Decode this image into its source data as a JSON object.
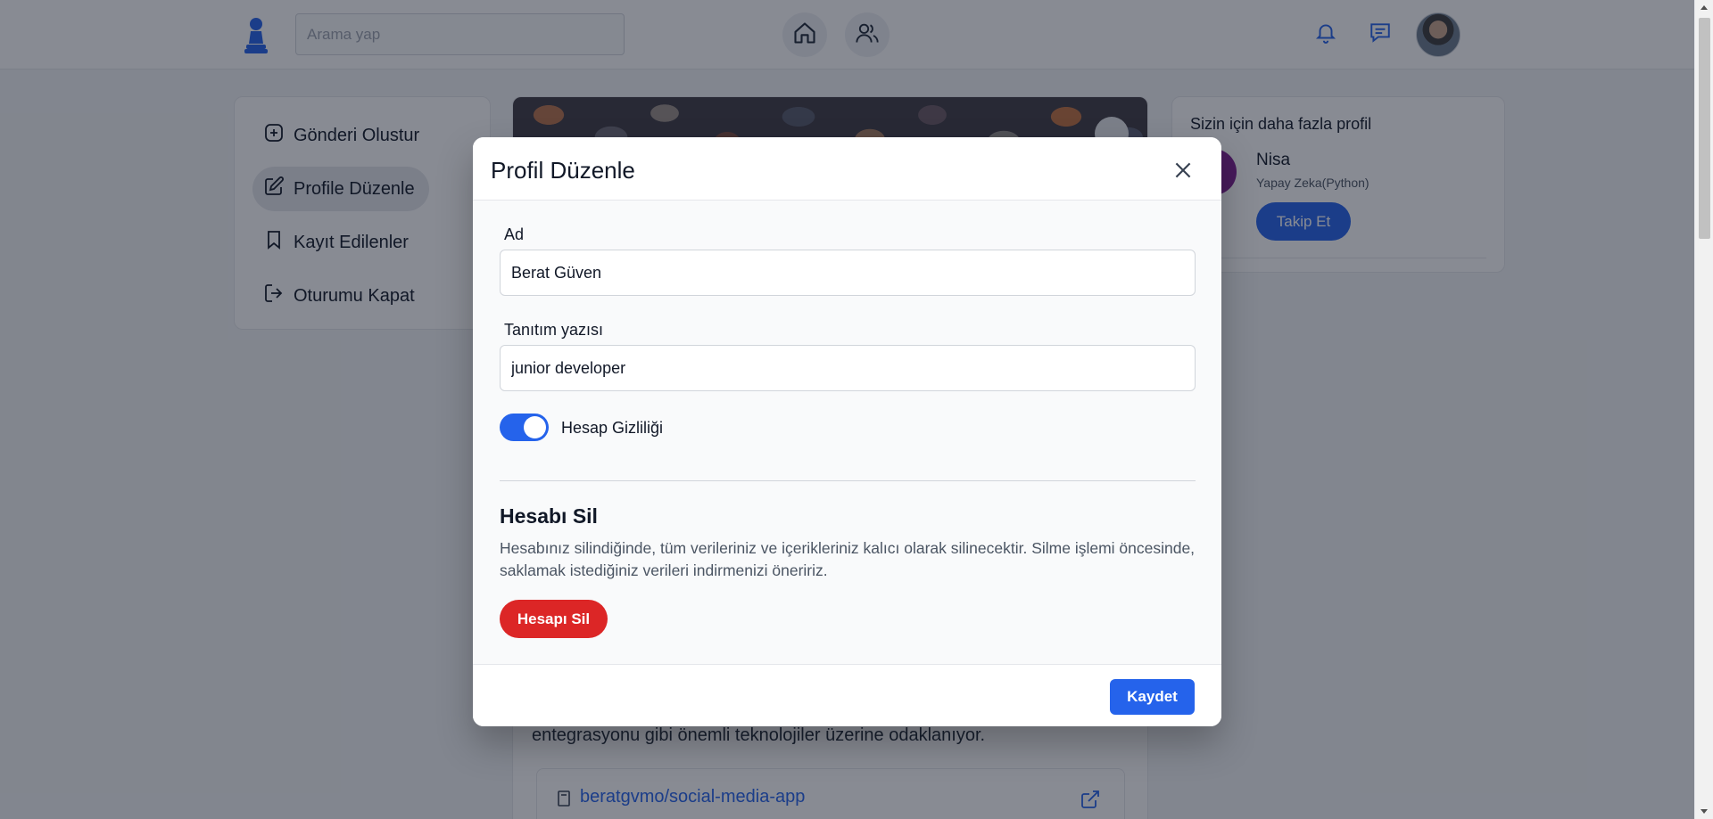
{
  "topbar": {
    "search_placeholder": "Arama yap"
  },
  "sidebar": {
    "items": [
      {
        "label": "Gönderi Olustur"
      },
      {
        "label": "Profile Düzenle"
      },
      {
        "label": "Kayıt Edilenler"
      },
      {
        "label": "Oturumu Kapat"
      }
    ]
  },
  "content": {
    "text_fragment": "entegrasyonu gibi önemli teknolojiler üzerine odaklanıyor.",
    "repo_link": "beratgvmo/social-media-app"
  },
  "suggestions": {
    "title": "Sizin için daha fazla profil",
    "profile": {
      "name": "Nisa",
      "subtitle": "Yapay Zeka(Python)",
      "follow_label": "Takip Et"
    }
  },
  "modal": {
    "title": "Profil Düzenle",
    "name_label": "Ad",
    "name_value": "Berat Güven",
    "bio_label": "Tanıtım yazısı",
    "bio_value": "junior developer",
    "privacy_label": "Hesap Gizliliği",
    "privacy_enabled": true,
    "delete_title": "Hesabı Sil",
    "delete_desc": "Hesabınız silindiğinde, tüm verileriniz ve içerikleriniz kalıcı olarak silinecektir. Silme işlemi öncesinde, saklamak istediğiniz verileri indirmenizi öneririz.",
    "delete_button": "Hesapı Sil",
    "save_button": "Kaydet"
  },
  "colors": {
    "primary": "#2563eb",
    "danger": "#dc2626",
    "overlay": "rgba(17,24,39,0.5)"
  }
}
